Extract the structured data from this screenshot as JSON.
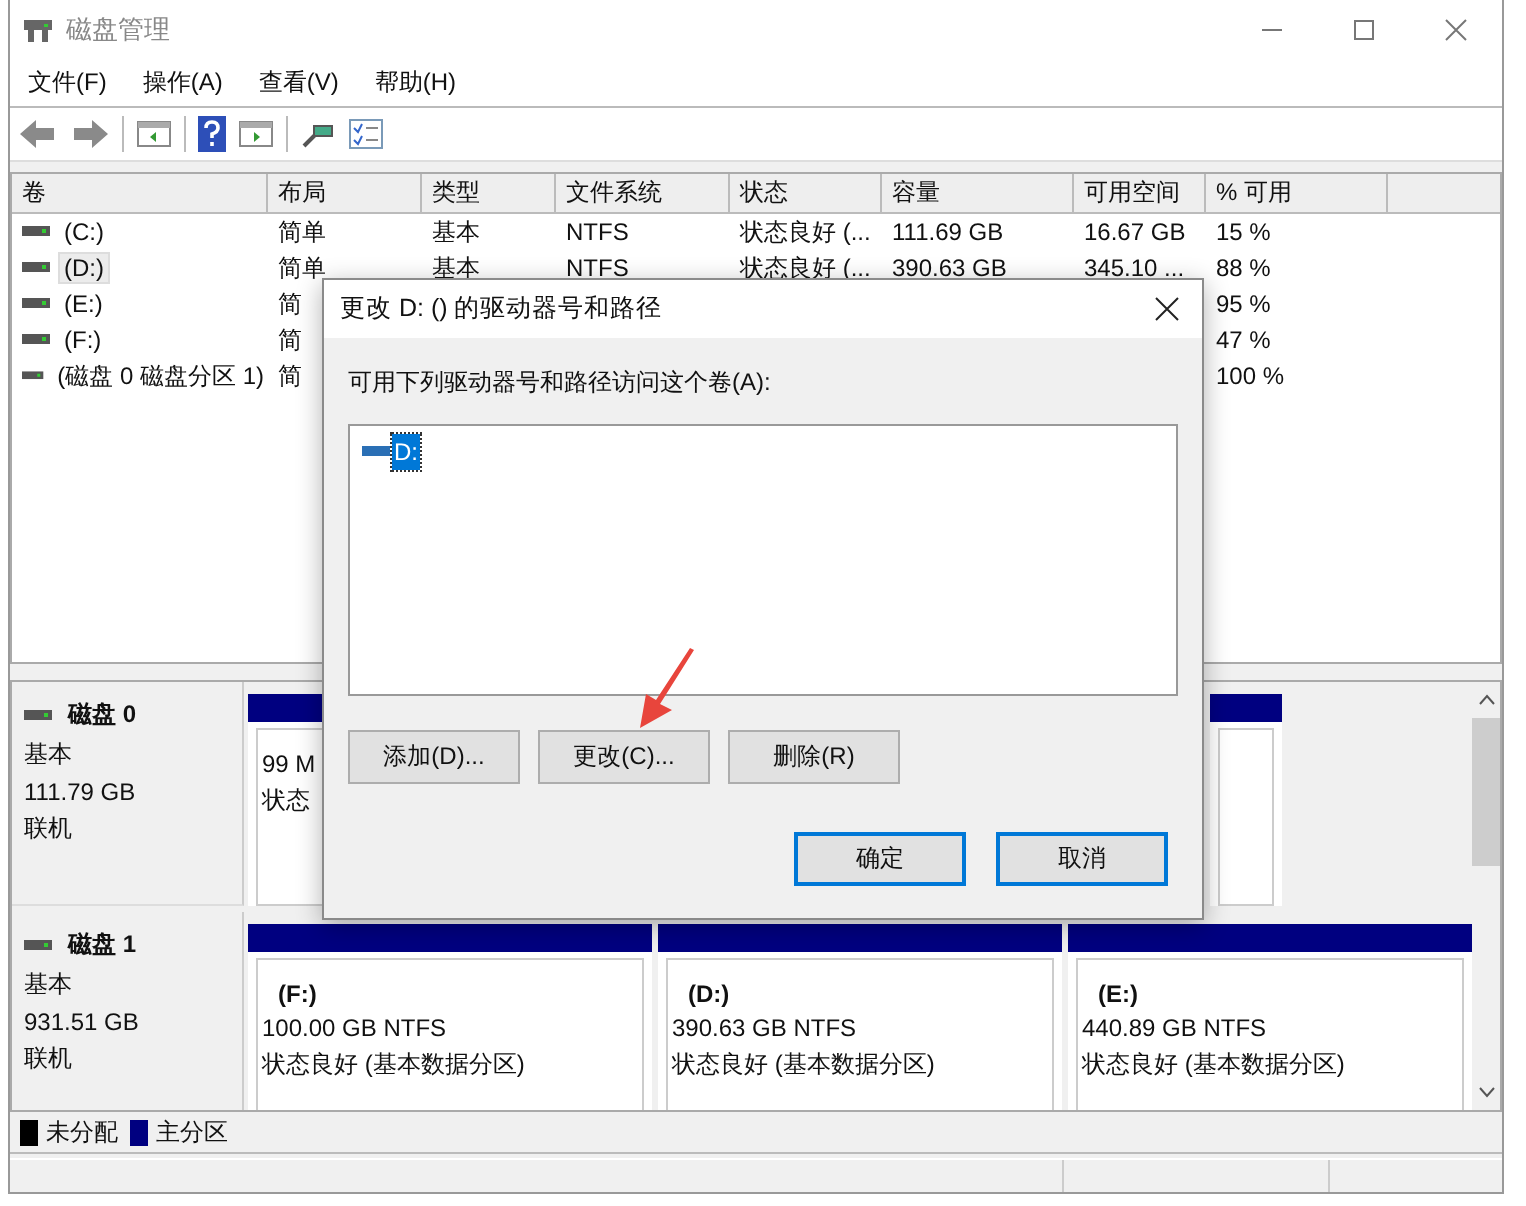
{
  "window": {
    "title": "磁盘管理"
  },
  "menu": [
    "文件(F)",
    "操作(A)",
    "查看(V)",
    "帮助(H)"
  ],
  "table": {
    "columns": [
      "卷",
      "布局",
      "类型",
      "文件系统",
      "状态",
      "容量",
      "可用空间",
      "% 可用"
    ],
    "rows": [
      {
        "selected": false,
        "cells": [
          "(C:)",
          "简单",
          "基本",
          "NTFS",
          "状态良好 (...",
          "111.69 GB",
          "16.67 GB",
          "15 %"
        ]
      },
      {
        "selected": true,
        "cells": [
          "(D:)",
          "简单",
          "基本",
          "NTFS",
          "状态良好 (...",
          "390.63 GB",
          "345.10 ...",
          "88 %"
        ]
      },
      {
        "selected": false,
        "cells": [
          "(E:)",
          "简",
          null,
          null,
          null,
          null,
          null,
          "95 %"
        ]
      },
      {
        "selected": false,
        "cells": [
          "(F:)",
          "简",
          null,
          null,
          null,
          null,
          null,
          "47 %"
        ]
      },
      {
        "selected": false,
        "cells": [
          "(磁盘 0 磁盘分区 1)",
          "简",
          null,
          null,
          null,
          null,
          null,
          "100 %"
        ]
      }
    ]
  },
  "disks": [
    {
      "name": "磁盘 0",
      "type": "基本",
      "size": "111.79 GB",
      "status": "联机",
      "partitions": [
        {
          "kind": "primary",
          "size": "99 M",
          "status": "状态"
        },
        {
          "kind": "primary"
        }
      ]
    },
    {
      "name": "磁盘 1",
      "type": "基本",
      "size": "931.51 GB",
      "status": "联机",
      "partitions": [
        {
          "kind": "primary",
          "name": "(F:)",
          "size": "100.00 GB NTFS",
          "status": "状态良好 (基本数据分区)"
        },
        {
          "kind": "primary",
          "name": "(D:)",
          "size": "390.63 GB NTFS",
          "status": "状态良好 (基本数据分区)"
        },
        {
          "kind": "primary",
          "name": "(E:)",
          "size": "440.89 GB NTFS",
          "status": "状态良好 (基本数据分区)"
        }
      ]
    }
  ],
  "legend": [
    {
      "kind": "unallocated",
      "label": "未分配",
      "color": "#000000"
    },
    {
      "kind": "primary",
      "label": "主分区",
      "color": "#000080"
    }
  ],
  "dialog": {
    "title": "更改 D: () 的驱动器号和路径",
    "prompt": "可用下列驱动器号和路径访问这个卷(A):",
    "paths": [
      {
        "label": "D:",
        "selected": true
      }
    ],
    "buttons": [
      "添加(D)...",
      "更改(C)...",
      "删除(R)"
    ],
    "footer_buttons": [
      "确定",
      "取消"
    ]
  }
}
